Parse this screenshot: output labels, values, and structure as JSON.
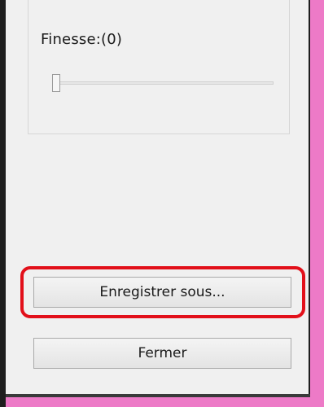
{
  "finesse": {
    "label": "Finesse:(0)",
    "slider_value": 0
  },
  "buttons": {
    "save_as_label": "Enregistrer sous...",
    "close_label": "Fermer"
  },
  "colors": {
    "highlight": "#e2101a",
    "frame_accent": "#ed7ac7",
    "window_border": "#1e1e1e"
  }
}
